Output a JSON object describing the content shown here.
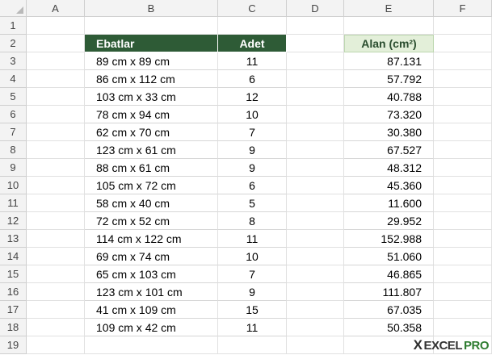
{
  "columns": [
    "A",
    "B",
    "C",
    "D",
    "E",
    "F"
  ],
  "rows": [
    "1",
    "2",
    "3",
    "4",
    "5",
    "6",
    "7",
    "8",
    "9",
    "10",
    "11",
    "12",
    "13",
    "14",
    "15",
    "16",
    "17",
    "18",
    "19"
  ],
  "table": {
    "header_ebatlar": "Ebatlar",
    "header_adet": "Adet",
    "header_alan": "Alan (cm²)",
    "rows": [
      {
        "ebat": "89 cm x 89 cm",
        "adet": "11",
        "alan": "87.131"
      },
      {
        "ebat": "86 cm x 112 cm",
        "adet": "6",
        "alan": "57.792"
      },
      {
        "ebat": "103 cm x 33 cm",
        "adet": "12",
        "alan": "40.788"
      },
      {
        "ebat": "78 cm x 94 cm",
        "adet": "10",
        "alan": "73.320"
      },
      {
        "ebat": "62 cm x 70 cm",
        "adet": "7",
        "alan": "30.380"
      },
      {
        "ebat": "123 cm x 61 cm",
        "adet": "9",
        "alan": "67.527"
      },
      {
        "ebat": "88 cm x 61 cm",
        "adet": "9",
        "alan": "48.312"
      },
      {
        "ebat": "105 cm x 72 cm",
        "adet": "6",
        "alan": "45.360"
      },
      {
        "ebat": "58 cm x 40 cm",
        "adet": "5",
        "alan": "11.600"
      },
      {
        "ebat": "72 cm x 52 cm",
        "adet": "8",
        "alan": "29.952"
      },
      {
        "ebat": "114 cm x 122 cm",
        "adet": "11",
        "alan": "152.988"
      },
      {
        "ebat": "69 cm x 74 cm",
        "adet": "10",
        "alan": "51.060"
      },
      {
        "ebat": "65 cm x 103 cm",
        "adet": "7",
        "alan": "46.865"
      },
      {
        "ebat": "123 cm x 101 cm",
        "adet": "9",
        "alan": "111.807"
      },
      {
        "ebat": "41 cm x 109 cm",
        "adet": "15",
        "alan": "67.035"
      },
      {
        "ebat": "109 cm x 42 cm",
        "adet": "11",
        "alan": "50.358"
      }
    ]
  },
  "watermark": {
    "excel": "EXCEL",
    "pro": "PRO",
    "x": "X"
  },
  "colors": {
    "header_green": "#2e5b36",
    "header_light": "#e3efd9",
    "watermark_green": "#2f7d31"
  }
}
